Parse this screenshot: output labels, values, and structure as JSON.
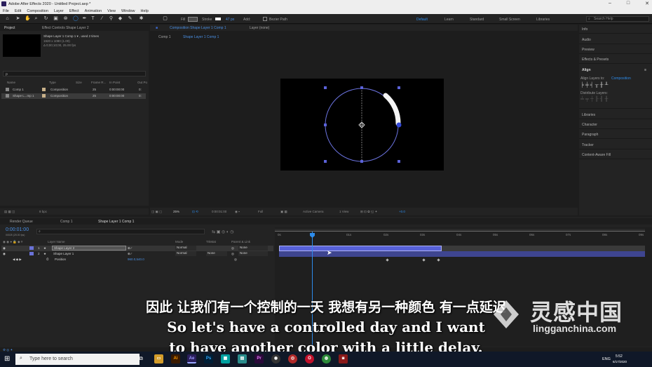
{
  "app": {
    "title": "Adobe After Effects 2020 - Untitled Project.aep *",
    "menu": [
      "File",
      "Edit",
      "Composition",
      "Layer",
      "Effect",
      "Animation",
      "View",
      "Window",
      "Help"
    ]
  },
  "toolbar": {
    "fill_label": "Fill",
    "stroke_label": "Stroke",
    "stroke_width": "47 px",
    "add_label": "Add:",
    "bezier_label": "Bezier Path",
    "workspaces": [
      "Default",
      "Learn",
      "Standard",
      "Small Screen",
      "Libraries"
    ],
    "search_placeholder": "Search Help"
  },
  "project": {
    "tabs": [
      "Project",
      "Effect Controls Shape Layer 2"
    ],
    "selected_name": "Shape Layer 1 Comp 1 ▾ , used 2 times",
    "info_line1": "1920 x 1080 (1.00)",
    "info_line2": "Δ 0;00;10;00, 25.00 fps",
    "search_icon_label": "ρ",
    "columns": [
      "Name",
      "Type",
      "Size",
      "Frame R...",
      "In Point",
      "Out Po"
    ],
    "rows": [
      {
        "name": "Comp 1",
        "type": "Composition",
        "fps": "25",
        "in": "0:00:00:00",
        "out": "0:"
      },
      {
        "name": "Shape L...mp 1",
        "type": "Composition",
        "fps": "25",
        "in": "0:00:00:00",
        "out": "0:"
      }
    ],
    "bpc": "8 bpc"
  },
  "composition": {
    "panel_tab": "Composition Shape Layer 1 Comp 1",
    "layer_tab": "Layer (none)",
    "breadcrumbs": [
      "Comp 1",
      "Shape Layer 1 Comp 1"
    ],
    "zoom": "25%",
    "timecode": "0:00:01:00",
    "resolution": "Full",
    "camera": "Active Camera",
    "views": "1 View",
    "exposure": "+0.0"
  },
  "right_panels": [
    "Info",
    "Audio",
    "Preview",
    "Effects & Presets",
    "Align",
    "Libraries",
    "Character",
    "Paragraph",
    "Tracker",
    "Content-Aware Fill"
  ],
  "align": {
    "label": "Align Layers to:",
    "value": "Composition",
    "distribute_label": "Distribute Layers:"
  },
  "timeline": {
    "tabs": [
      "Render Queue",
      "Comp 1",
      "Shape Layer 1 Comp 1"
    ],
    "current_time": "0:00:01:00",
    "time_sub": "00025 (25.00 fps)",
    "columns": [
      "Layer Name",
      "Mode",
      "TrkMat",
      "Parent & Link"
    ],
    "layers": [
      {
        "num": "1",
        "name": "Shape Layer 2",
        "mode": "Normal",
        "trkmat": "",
        "parent": "None",
        "color": "#6a72d8"
      },
      {
        "num": "2",
        "name": "Shape Layer 1",
        "mode": "Normal",
        "trkmat": "None",
        "parent": "None",
        "color": "#6a72d8"
      }
    ],
    "position_row": {
      "label": "Position",
      "value": "960.0,540.0"
    },
    "ruler": [
      "0s",
      "01s",
      "02s",
      "03s",
      "04s",
      "05s",
      "06s",
      "07s",
      "08s",
      "09s",
      "10s"
    ],
    "toggle_label": "Toggle Switches / Modes",
    "frame_render": "Frame Render Time 0ms"
  },
  "subtitles": {
    "chinese": "因此 让我们有一个控制的一天 我想有另一种颜色 有一点延迟",
    "english_line1": "So let's have a controlled day and I want",
    "english_line2": "to have another color with a little delay."
  },
  "watermark": {
    "brand_cn": "灵感中国",
    "url": "lingganchina.com"
  },
  "taskbar": {
    "search_placeholder": "Type here to search",
    "apps": [
      "Ae",
      "Ai",
      "Ps",
      "Ae",
      "Pr"
    ],
    "lang": "ENG",
    "time": "5:52",
    "date": "6/17/2020",
    "colors": {
      "ae": "#2a1e5c",
      "ai": "#3a1a00",
      "ps": "#001e36",
      "pr": "#2a0a3a",
      "accent": "#2d8ceb"
    }
  }
}
